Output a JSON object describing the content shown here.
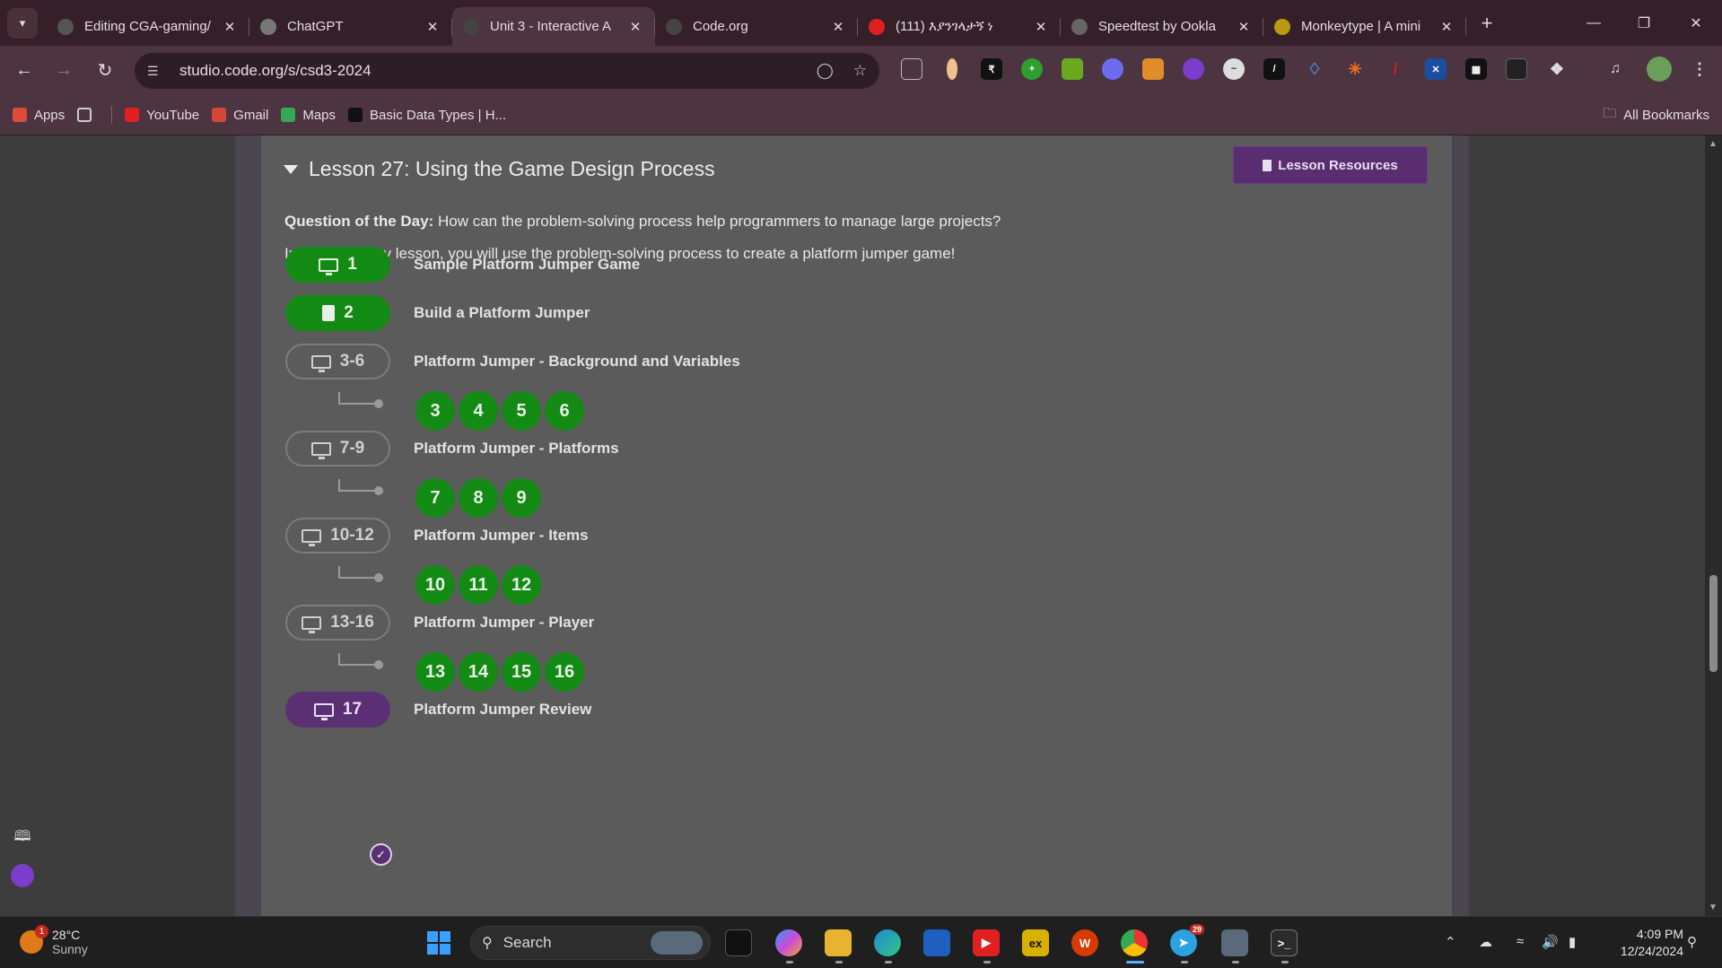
{
  "browser": {
    "tabs": [
      {
        "title": "Editing CGA-gaming/",
        "icon": "github-icon",
        "color": "#555555"
      },
      {
        "title": "ChatGPT",
        "icon": "openai-icon",
        "color": "#777777"
      },
      {
        "title": "Unit 3 - Interactive A",
        "icon": "codeorg-icon",
        "color": "#444444"
      },
      {
        "title": "Code.org",
        "icon": "codeorg-icon",
        "color": "#444444"
      },
      {
        "title": "(111) እያንገላታኝ ነ",
        "icon": "youtube-icon",
        "color": "#e02020"
      },
      {
        "title": "Speedtest by Ookla",
        "icon": "speedtest-icon",
        "color": "#666666"
      },
      {
        "title": "Monkeytype | A mini",
        "icon": "monkeytype-icon",
        "color": "#b89a10"
      }
    ],
    "active_tab_index": 2,
    "url": "studio.code.org/s/csd3-2024",
    "bookmarks": [
      {
        "label": "Apps",
        "icon": "apps-grid-icon"
      },
      {
        "label": "",
        "icon": "tab-groups-icon"
      },
      {
        "label": "YouTube",
        "icon": "youtube-icon"
      },
      {
        "label": "Gmail",
        "icon": "gmail-icon"
      },
      {
        "label": "Maps",
        "icon": "maps-icon"
      },
      {
        "label": "Basic Data Types | H...",
        "icon": "hackerrank-icon"
      }
    ],
    "all_bookmarks_label": "All Bookmarks"
  },
  "lesson": {
    "title": "Lesson 27: Using the Game Design Process",
    "resources_button": "Lesson Resources",
    "qotd_label": "Question of the Day:",
    "qotd_text": " How can the problem-solving process help programmers to manage large projects?",
    "intro": "In this multi-day lesson, you will use the problem-solving process to create a platform jumper game!",
    "activities": [
      {
        "pill": "1",
        "style": "filled",
        "icon": "monitor-icon",
        "label": "Sample Platform Jumper Game",
        "levels": []
      },
      {
        "pill": "2",
        "style": "filled",
        "icon": "document-icon",
        "label": "Build a Platform Jumper",
        "levels": []
      },
      {
        "pill": "3-6",
        "style": "outline",
        "icon": "monitor-icon",
        "label": "Platform Jumper - Background and Variables",
        "levels": [
          "3",
          "4",
          "5",
          "6"
        ]
      },
      {
        "pill": "7-9",
        "style": "outline",
        "icon": "monitor-icon",
        "label": "Platform Jumper - Platforms",
        "levels": [
          "7",
          "8",
          "9"
        ]
      },
      {
        "pill": "10-12",
        "style": "outline",
        "icon": "monitor-icon",
        "label": "Platform Jumper - Items",
        "levels": [
          "10",
          "11",
          "12"
        ]
      },
      {
        "pill": "13-16",
        "style": "outline",
        "icon": "monitor-icon",
        "label": "Platform Jumper - Player",
        "levels": [
          "13",
          "14",
          "15",
          "16"
        ]
      },
      {
        "pill": "17",
        "style": "purple",
        "icon": "monitor-icon",
        "label": "Platform Jumper Review",
        "levels": [],
        "completed": true
      }
    ]
  },
  "taskbar": {
    "weather_temp": "28°C",
    "weather_desc": "Sunny",
    "weather_badge": "1",
    "search_placeholder": "Search",
    "telegram_badge": "29",
    "time": "4:09 PM",
    "date": "12/24/2024"
  },
  "colors": {
    "level_green": "#138a13",
    "review_purple": "#5b2f74",
    "resources_purple": "#5a2d70",
    "chrome_maroon": "#4c3440"
  }
}
